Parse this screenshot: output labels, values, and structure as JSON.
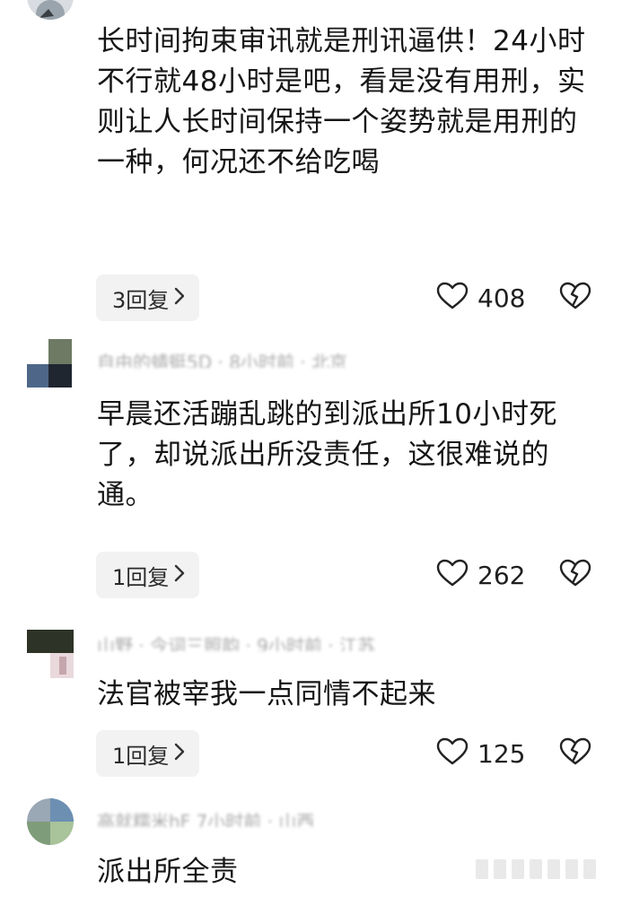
{
  "comments": [
    {
      "text": "长时间拘束审讯就是刑讯逼供！24小时不行就48小时是吧，看是没有用刑，实则让人长时间保持一个姿势就是用刑的一种，何况还不给吃喝",
      "reply_label": "3回复",
      "likes": "408"
    },
    {
      "meta": "自由的蜻蜓5D · 8小时前 · 北京",
      "text": "早晨还活蹦乱跳的到派出所10小时死了，却说派出所没责任，这很难说的通。",
      "reply_label": "1回复",
      "likes": "262"
    },
    {
      "meta": "山野 · 今词三照韵 · 9小时前 · 江苏",
      "text": "法官被宰我一点同情不起来",
      "reply_label": "1回复",
      "likes": "125"
    },
    {
      "meta": "高就糯米hF 7小时前 · 山西",
      "text": "派出所全责"
    }
  ],
  "icons": {
    "like": "heart-outline-icon",
    "dislike": "broken-heart-icon",
    "reply_chevron": "chevron-right-icon"
  },
  "colors": {
    "reply_bg": "#f2f2f2",
    "meta_text": "#9a9a9a"
  }
}
